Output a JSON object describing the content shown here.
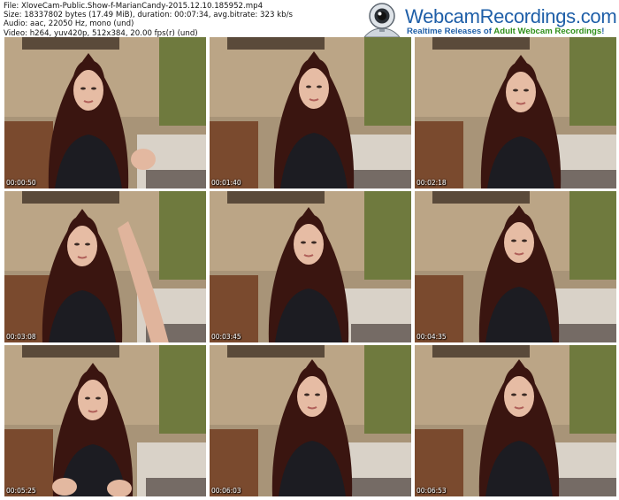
{
  "file_info": {
    "line1": "File: XloveCam-Public.Show-f-MarianCandy-2015.12.10.185952.mp4",
    "line2": "Size: 18337802 bytes (17.49 MiB), duration: 00:07:34, avg.bitrate: 323 kb/s",
    "line3": "Audio: aac, 22050 Hz, mono (und)",
    "line4": "Video: h264, yuv420p, 512x384, 20.00 fps(r) (und)"
  },
  "logo": {
    "title": "WebcamRecordings.com",
    "tagline_pre": "Realtime Releases of ",
    "tagline_hl": "Adult Webcam Recordings",
    "tagline_post": "!",
    "icon": "webcam-icon"
  },
  "thumbnails": [
    {
      "timestamp": "00:00:50"
    },
    {
      "timestamp": "00:01:40"
    },
    {
      "timestamp": "00:02:18"
    },
    {
      "timestamp": "00:03:08"
    },
    {
      "timestamp": "00:03:45"
    },
    {
      "timestamp": "00:04:35"
    },
    {
      "timestamp": "00:05:25"
    },
    {
      "timestamp": "00:06:03"
    },
    {
      "timestamp": "00:06:53"
    }
  ]
}
